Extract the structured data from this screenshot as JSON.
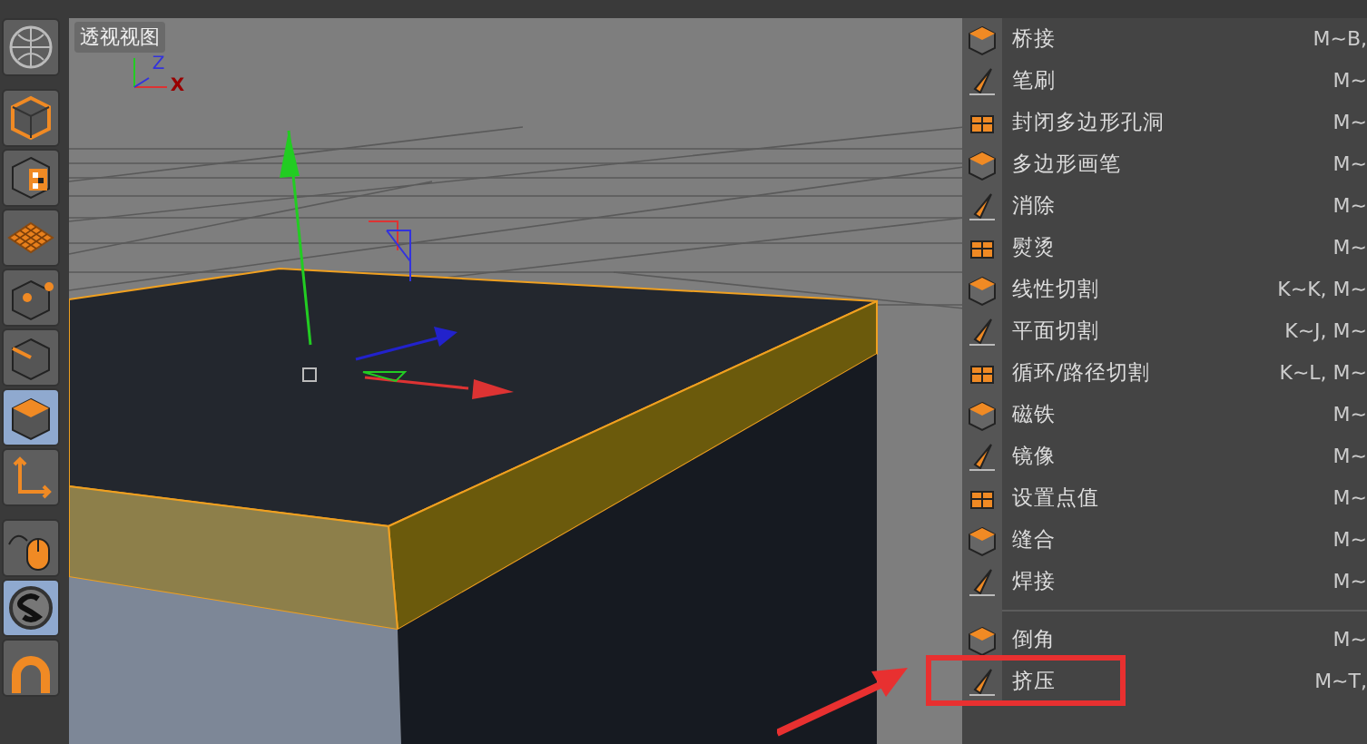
{
  "toolbar": {
    "tools": [
      {
        "kind": "globe",
        "selected": false
      },
      {
        "kind": "cube",
        "selected": false
      },
      {
        "kind": "checker",
        "selected": false
      },
      {
        "kind": "grid",
        "selected": false
      },
      {
        "kind": "points",
        "selected": false
      },
      {
        "kind": "edges",
        "selected": false
      },
      {
        "kind": "polygons",
        "selected": true
      },
      {
        "kind": "axis",
        "selected": false
      },
      {
        "kind": "mouse",
        "selected": false
      },
      {
        "kind": "snap",
        "selected": true
      },
      {
        "kind": "magnet",
        "selected": false
      }
    ]
  },
  "viewport": {
    "title": "透视视图",
    "axis_labels": [
      "Z",
      "X"
    ]
  },
  "menu": {
    "items": [
      {
        "kind": "tool",
        "label": "桥接",
        "shortcut": "M~B,",
        "highlighted": false
      },
      {
        "kind": "tool",
        "label": "笔刷",
        "shortcut": "M~",
        "highlighted": false
      },
      {
        "kind": "tool",
        "label": "封闭多边形孔洞",
        "shortcut": "M~",
        "highlighted": false
      },
      {
        "kind": "tool",
        "label": "多边形画笔",
        "shortcut": "M~",
        "highlighted": false
      },
      {
        "kind": "tool",
        "label": "消除",
        "shortcut": "M~",
        "highlighted": false
      },
      {
        "kind": "tool",
        "label": "熨烫",
        "shortcut": "M~",
        "highlighted": false
      },
      {
        "kind": "tool",
        "label": "线性切割",
        "shortcut": "K~K, M~",
        "highlighted": false
      },
      {
        "kind": "tool",
        "label": "平面切割",
        "shortcut": "K~J, M~",
        "highlighted": false
      },
      {
        "kind": "tool",
        "label": "循环/路径切割",
        "shortcut": "K~L, M~",
        "highlighted": false
      },
      {
        "kind": "tool",
        "label": "磁铁",
        "shortcut": "M~",
        "highlighted": false
      },
      {
        "kind": "tool",
        "label": "镜像",
        "shortcut": "M~",
        "highlighted": false
      },
      {
        "kind": "tool",
        "label": "设置点值",
        "shortcut": "M~",
        "highlighted": false
      },
      {
        "kind": "tool",
        "label": "缝合",
        "shortcut": "M~",
        "highlighted": false
      },
      {
        "kind": "tool",
        "label": "焊接",
        "shortcut": "M~",
        "highlighted": false
      },
      {
        "kind": "separator"
      },
      {
        "kind": "tool",
        "label": "倒角",
        "shortcut": "M~",
        "highlighted": false
      },
      {
        "kind": "tool",
        "label": "挤压",
        "shortcut": "M~T,",
        "highlighted": true
      }
    ]
  }
}
